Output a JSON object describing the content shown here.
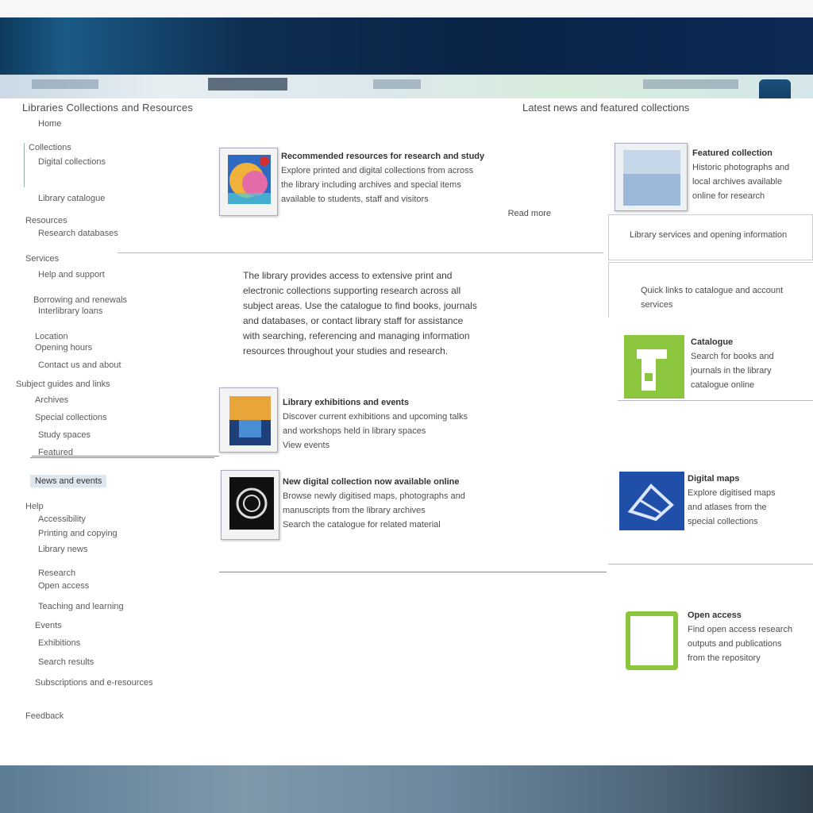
{
  "window": {
    "title": ""
  },
  "sidebar": {
    "title": "Libraries Collections and Resources",
    "subtitle": "Home",
    "items": [
      {
        "label": "Collections"
      },
      {
        "label": "Digital collections"
      },
      {
        "label": "Library catalogue"
      },
      {
        "label": "Resources"
      },
      {
        "label": "Research databases"
      },
      {
        "label": "Services"
      },
      {
        "label": "Help and support"
      },
      {
        "label": "Borrowing and renewals"
      },
      {
        "label": "Interlibrary loans"
      },
      {
        "label": "Location"
      },
      {
        "label": "Opening hours"
      },
      {
        "label": "Contact us and about"
      },
      {
        "label": "Subject guides and links"
      },
      {
        "label": "Archives"
      },
      {
        "label": "Special collections"
      },
      {
        "label": "Study spaces"
      },
      {
        "label": "Featured"
      },
      {
        "label": "News and events"
      },
      {
        "label": "Help"
      },
      {
        "label": "Accessibility"
      },
      {
        "label": "Printing and copying"
      },
      {
        "label": "Library news"
      },
      {
        "label": "Research"
      },
      {
        "label": "Open access"
      },
      {
        "label": "Teaching and learning"
      },
      {
        "label": "Events"
      },
      {
        "label": "Exhibitions"
      },
      {
        "label": "Search results"
      },
      {
        "label": "Subscriptions and e-resources"
      },
      {
        "label": "Feedback"
      }
    ]
  },
  "section": {
    "title": "Latest news and featured collections"
  },
  "cards_left": [
    {
      "lines": [
        "Recommended resources for research and study",
        "Explore printed and digital collections from across",
        "the library including archives and special items",
        "available to students, staff and visitors"
      ],
      "link": "Read more"
    },
    {
      "lines": [
        "Library exhibitions and events",
        "Discover current exhibitions and upcoming talks",
        "and workshops held in library spaces"
      ],
      "link": "View events"
    },
    {
      "lines": [
        "New digital collection now available online",
        "Browse newly digitised maps, photographs and",
        "manuscripts from the library archives",
        "Search the catalogue for related material"
      ],
      "link": ""
    }
  ],
  "body": {
    "lines": [
      "The library provides access to extensive print and",
      "electronic collections supporting research across all",
      "subject areas. Use the catalogue to find books, journals",
      "and databases, or contact library staff for assistance",
      "with searching, referencing and managing information",
      "resources throughout your studies and research."
    ]
  },
  "cards_right": [
    {
      "lines": [
        "Featured collection",
        "Historic photographs and",
        "local archives available",
        "online for research"
      ]
    },
    {
      "lines": [
        "Library services and opening information"
      ]
    },
    {
      "lines": [
        "Quick links to catalogue and account services"
      ]
    },
    {
      "lines": [
        "Catalogue",
        "Search for books and",
        "journals in the library",
        "catalogue online"
      ]
    },
    {
      "lines": [
        "Digital maps",
        "Explore digitised maps",
        "and atlases from the",
        "special collections"
      ]
    },
    {
      "lines": [
        "Open access",
        "Find open access research",
        "outputs and publications",
        "from the repository"
      ]
    }
  ],
  "colors": {
    "header": "#0a2347",
    "accent_green": "#8cc63f",
    "accent_blue": "#1f4fa8",
    "footer": "#5d7d96"
  }
}
